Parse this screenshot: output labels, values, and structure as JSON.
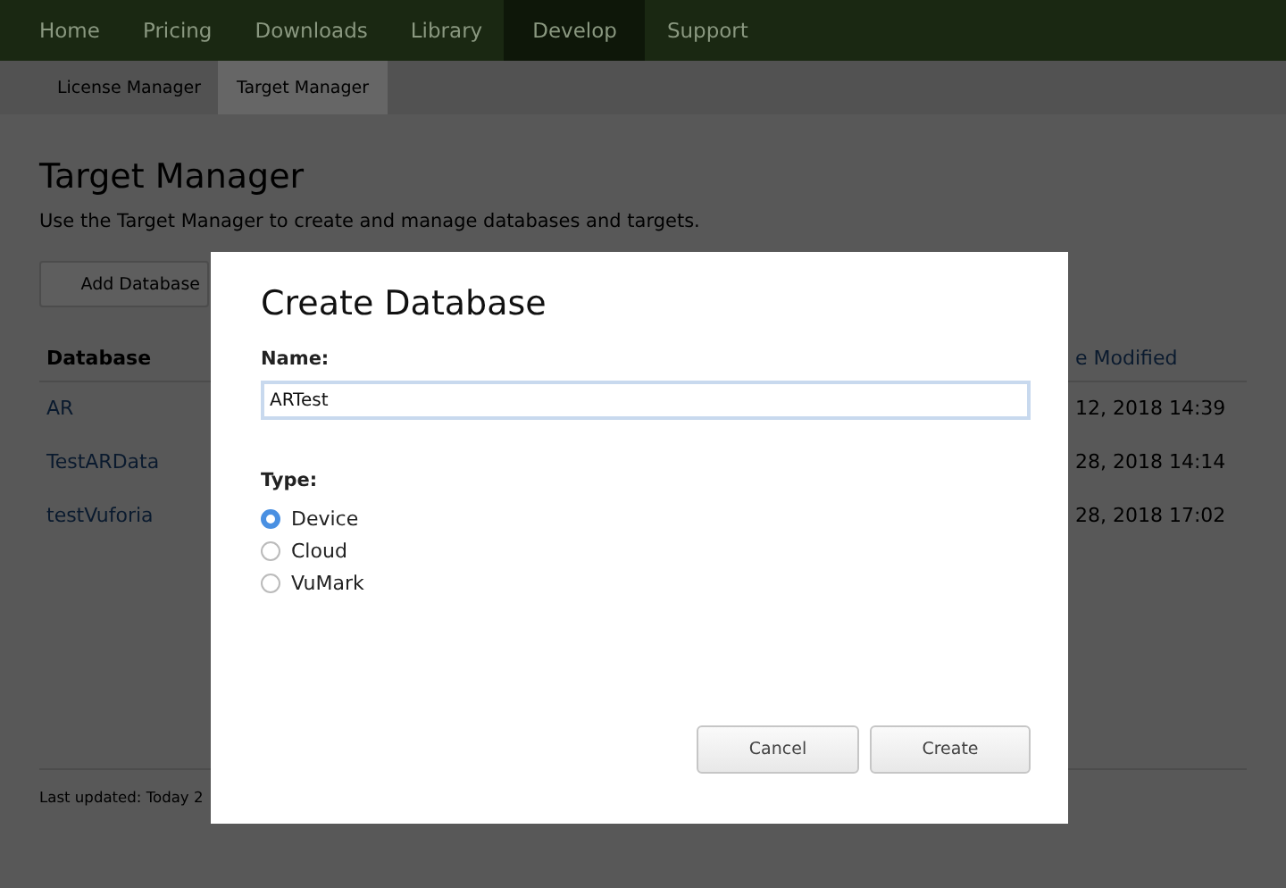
{
  "nav": [
    {
      "label": "Home",
      "selected": false
    },
    {
      "label": "Pricing",
      "selected": false
    },
    {
      "label": "Downloads",
      "selected": false
    },
    {
      "label": "Library",
      "selected": false
    },
    {
      "label": "Develop",
      "selected": true
    },
    {
      "label": "Support",
      "selected": false
    }
  ],
  "subnav": [
    {
      "label": "License Manager",
      "selected": false
    },
    {
      "label": "Target Manager",
      "selected": true
    }
  ],
  "page": {
    "title": "Target Manager",
    "description": "Use the Target Manager to create and manage databases and targets.",
    "add_button": "Add Database"
  },
  "table": {
    "columns": [
      "Database",
      "e Modified"
    ],
    "rows": [
      {
        "database": "AR",
        "modified": "12, 2018 14:39"
      },
      {
        "database": "TestARData",
        "modified": "28, 2018 14:14"
      },
      {
        "database": "testVuforia",
        "modified": "28, 2018 17:02"
      }
    ]
  },
  "footer": "Last updated: Today 2",
  "dialog": {
    "title": "Create Database",
    "name_label": "Name:",
    "name_value": "ARTest",
    "type_label": "Type:",
    "types": [
      {
        "label": "Device",
        "selected": true
      },
      {
        "label": "Cloud",
        "selected": false
      },
      {
        "label": "VuMark",
        "selected": false
      }
    ],
    "buttons": [
      "Cancel",
      "Create"
    ]
  }
}
